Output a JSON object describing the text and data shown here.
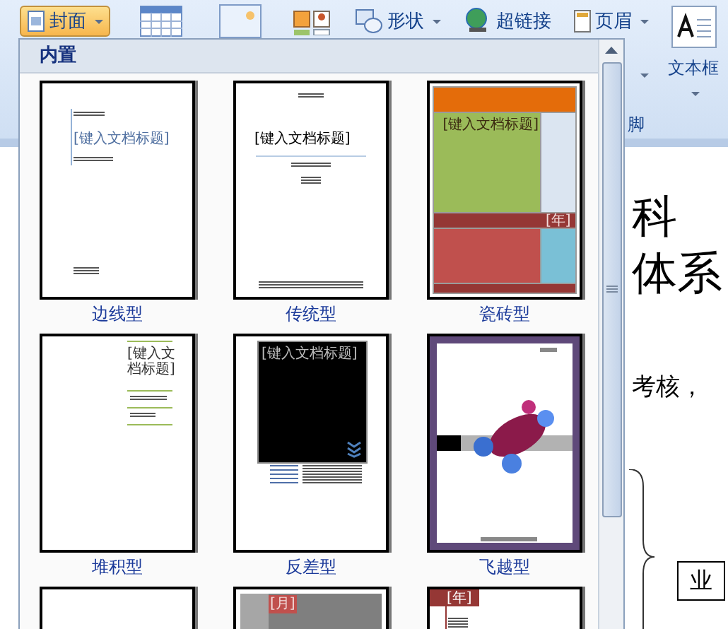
{
  "ribbon": {
    "buttons": [
      {
        "kind": "cover",
        "label": "封面",
        "caret": true,
        "selected": true
      },
      {
        "kind": "table",
        "selected": false
      },
      {
        "kind": "picture",
        "selected": false
      },
      {
        "kind": "clipart",
        "selected": false
      },
      {
        "kind": "shapes",
        "label": "形状",
        "caret": true,
        "selected": false
      },
      {
        "kind": "hyperlink",
        "label": "超链接",
        "selected": false
      },
      {
        "kind": "header",
        "label": "页眉",
        "caret": true,
        "selected": false
      }
    ],
    "footer_group_label": "脚",
    "textbox_label": "文本框"
  },
  "gallery": {
    "heading": "内置",
    "items": [
      {
        "kind": "sideline",
        "name": "边线型",
        "title": "[键入文档标题]"
      },
      {
        "kind": "traditional",
        "name": "传统型",
        "title": "[键入文档标题]"
      },
      {
        "kind": "tiles",
        "name": "瓷砖型",
        "title": "[键入文档标题]",
        "year": "[年]"
      },
      {
        "kind": "stacked",
        "name": "堆积型",
        "title": "[键入文档标题]"
      },
      {
        "kind": "contrast",
        "name": "反差型",
        "title": "[键入文档标题]"
      },
      {
        "kind": "motion",
        "name": "飞越型"
      },
      {
        "kind": "blank"
      },
      {
        "kind": "grey",
        "month": "[月]"
      },
      {
        "kind": "year",
        "year": "[年]"
      }
    ]
  },
  "document": {
    "lines": [
      "科",
      "体系",
      "考核，"
    ],
    "box_label": "业"
  }
}
